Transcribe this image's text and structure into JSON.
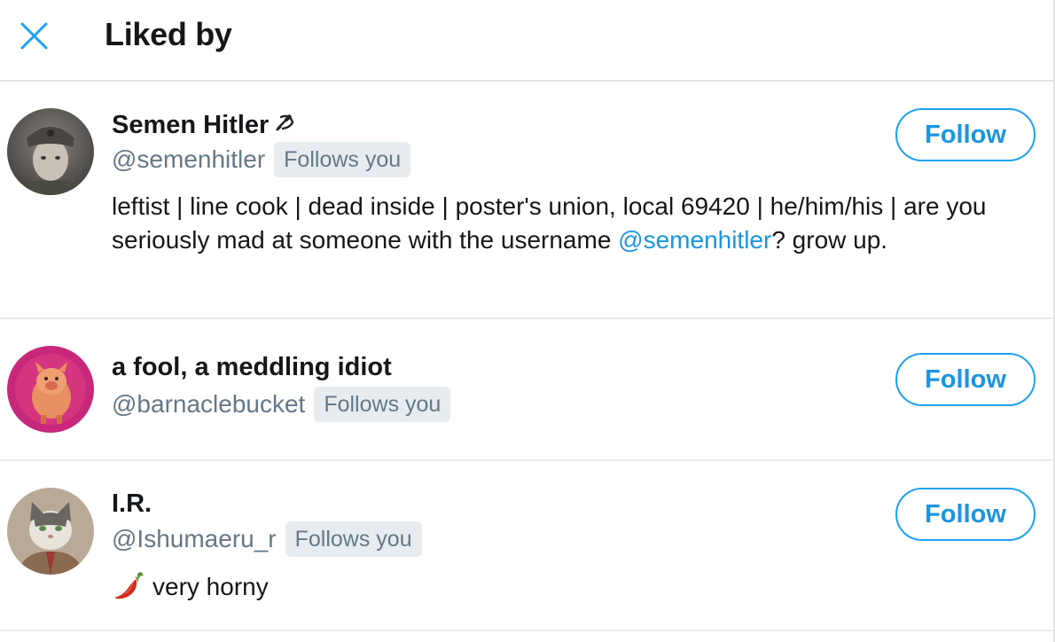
{
  "header": {
    "title": "Liked by",
    "close_icon": "close-icon"
  },
  "colors": {
    "link": "#1b95e0",
    "follow_border": "#1da1f2",
    "muted": "#657786",
    "badge_bg": "#e6ecf0"
  },
  "users": [
    {
      "name": "Semen Hitler",
      "name_emoji": "hammer-and-sickle-icon",
      "handle": "@semenhitler",
      "badge": "Follows you",
      "bio_part1": "leftist | line cook | dead inside | poster's union, local 69420 | he/him/his | are you seriously mad at someone with the username ",
      "bio_mention": "@semenhitler",
      "bio_part2": "? grow up.",
      "follow_label": "Follow"
    },
    {
      "name": "a fool, a meddling idiot",
      "handle": "@barnaclebucket",
      "badge": "Follows you",
      "follow_label": "Follow"
    },
    {
      "name": "I.R.",
      "handle": "@Ishumaeru_r",
      "badge": "Follows you",
      "bio_emoji": "hot-pepper-icon",
      "bio": "very horny",
      "follow_label": "Follow"
    }
  ]
}
